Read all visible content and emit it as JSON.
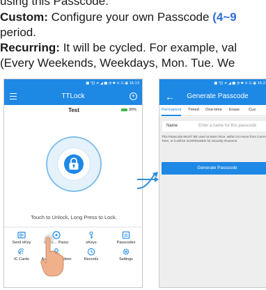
{
  "doc": {
    "line1_text": "using this Passcode.",
    "line2_label": "Custom:",
    "line2_text": " Configure your own Passcode ",
    "line2_accent": "(4~9",
    "line3_text": "period.",
    "line4_label": "Recurring:",
    "line4_text": " It will be cycled. For example, val",
    "line5_text": "(Every Weekends, Weekdays, Mon. Tue. We"
  },
  "left_phone": {
    "status_text": "■ °∥⌈ ≡ ◢ ■  ◔ ✱ ⊙ ☷ ▣ 16:13",
    "title": "TTLock",
    "lock_name": "Test",
    "battery": "30%",
    "touch_hint": "Touch to Unlock, Long Press to Lock.",
    "grid": [
      {
        "label": "Send eKey",
        "icon": "send-ekey-icon"
      },
      {
        "label": "Generate Passcode",
        "label_visible": "Genе… Passc",
        "icon": "generate-passcode-icon"
      },
      {
        "label": "eKeys",
        "icon": "ekeys-icon"
      },
      {
        "label": "Passcodes",
        "icon": "passcodes-icon"
      },
      {
        "label": "IC Cards",
        "icon": "ic-cards-icon"
      },
      {
        "label": "Authorized Admin",
        "icon": "authorized-admin-icon"
      },
      {
        "label": "Records",
        "icon": "records-icon"
      },
      {
        "label": "Settings",
        "icon": "settings-icon"
      }
    ]
  },
  "right_phone": {
    "status_text": "■ °∥⌈ ≡ ◢ ■  ◔ ✱ ⊙ ☷ ▣ 16:21",
    "title": "Generate Passcode",
    "tabs": [
      "Permanent",
      "Timed",
      "One-time",
      "Erase",
      "Cus"
    ],
    "active_tab": "Permanent",
    "name_label": "Name",
    "name_placeholder": "Enter a name for this passcode",
    "note": "This Passcode MUST BE used at least Once, within 24 Hours from Current Time, or it will be SUSPENDED for Security Reasons.",
    "generate_button": "Generate Passcode"
  },
  "colors": {
    "primary": "#1e88e5",
    "doc_accent": "#2f6fd6",
    "battery": "#3bb54a",
    "arrow": "#2e8fd8"
  }
}
